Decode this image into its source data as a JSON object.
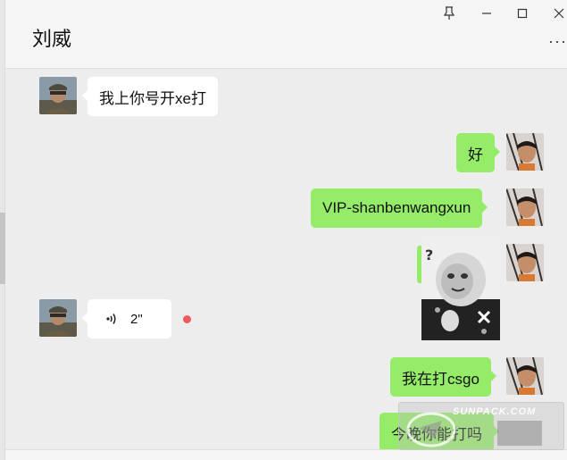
{
  "window": {
    "title": "刘威",
    "controls": {
      "pin": "pin-icon",
      "minimize": "minimize-icon",
      "maximize": "maximize-icon",
      "close": "close-icon"
    },
    "more": "···"
  },
  "messages": [
    {
      "type": "text",
      "side": "in",
      "text": "我上你号开xe打"
    },
    {
      "type": "text",
      "side": "out",
      "text": "好"
    },
    {
      "type": "text",
      "side": "out",
      "text": "VIP-shanbenwangxun"
    },
    {
      "type": "sticker",
      "side": "out"
    },
    {
      "type": "voice",
      "side": "in",
      "duration": "2\"",
      "unread": true
    },
    {
      "type": "text",
      "side": "out",
      "text": "我在打csgo"
    },
    {
      "type": "text",
      "side": "out",
      "text": "今晚你能打吗"
    }
  ],
  "watermark": {
    "text": "SUNPACK.COM"
  },
  "colors": {
    "out_bubble": "#95ec69",
    "in_bubble": "#ffffff",
    "background": "#ededed",
    "unread_dot": "#f05a5a"
  }
}
